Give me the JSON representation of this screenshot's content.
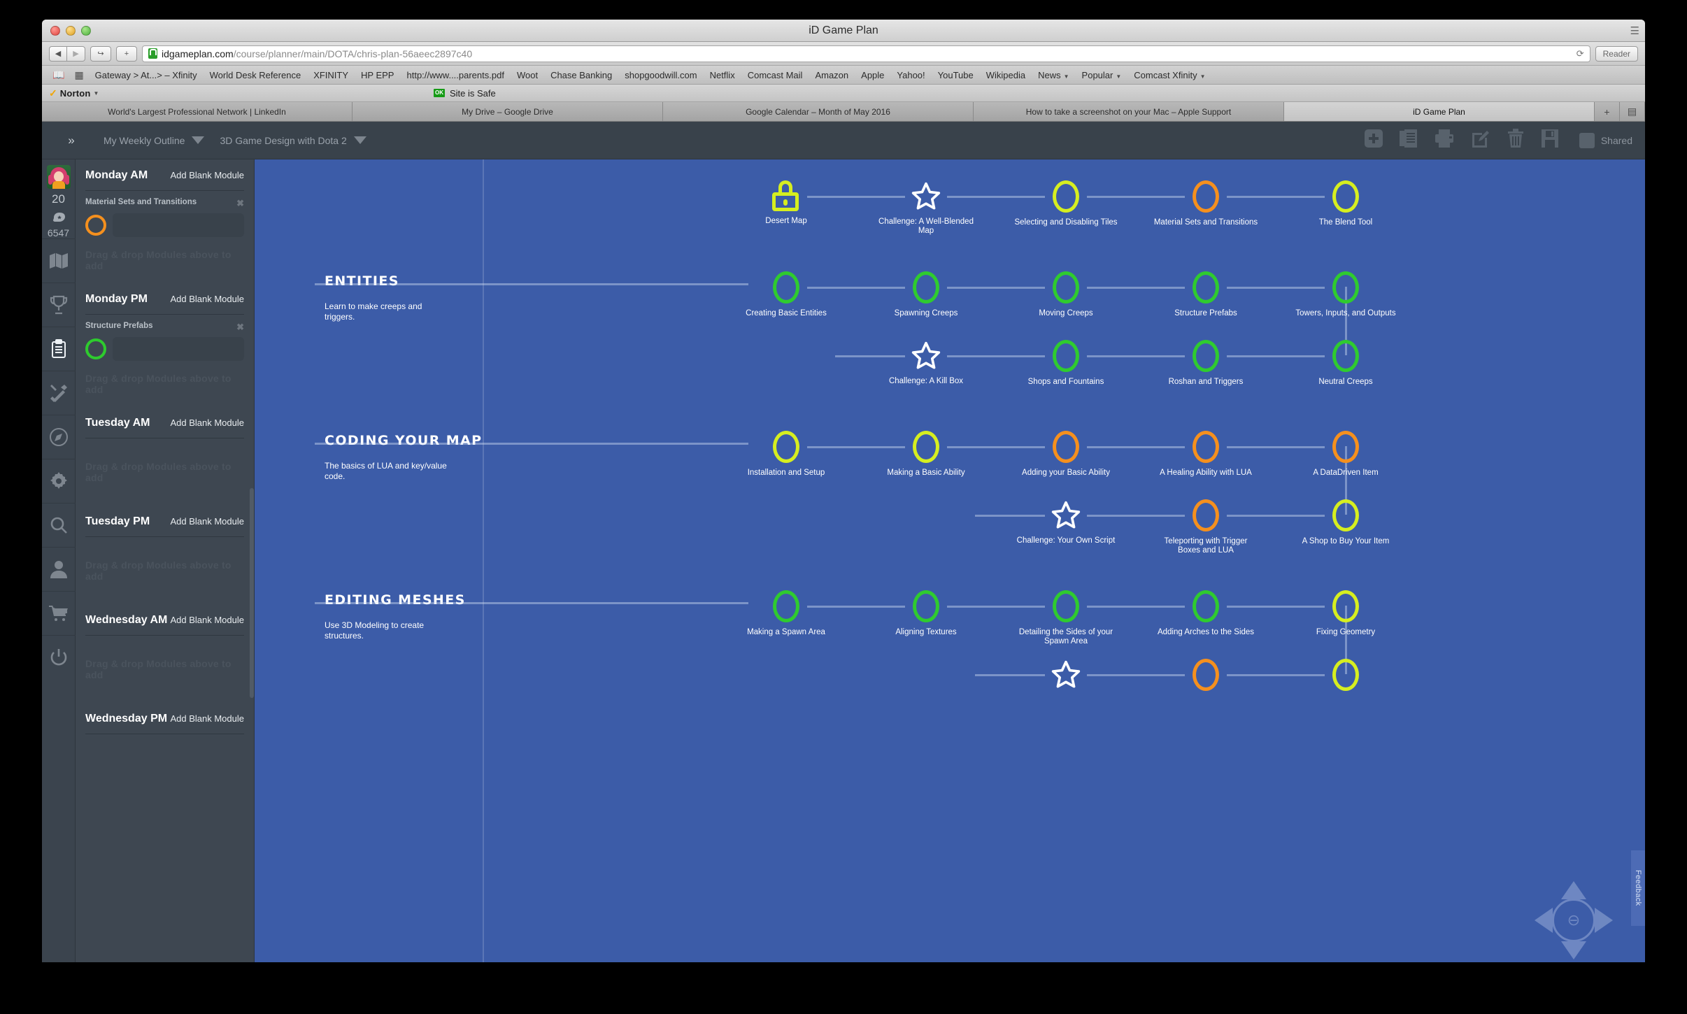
{
  "window": {
    "title": "iD Game Plan"
  },
  "browser": {
    "url_host": "idgameplan.com",
    "url_path": "/course/planner/main/DOTA/chris-plan-56aeec2897c40",
    "reader_label": "Reader",
    "back_glyph": "◀",
    "forward_glyph": "▶",
    "share_glyph": "↪",
    "newtab_glyph": "+",
    "reload_glyph": "⟳",
    "bookmarks_icons": [
      "book-icon",
      "grid-icon"
    ],
    "bookmarks": [
      {
        "label": "Gateway > At...> – Xfinity",
        "dropdown": false
      },
      {
        "label": "World Desk Reference",
        "dropdown": false
      },
      {
        "label": "XFINITY",
        "dropdown": false
      },
      {
        "label": "HP EPP",
        "dropdown": false
      },
      {
        "label": "http://www....parents.pdf",
        "dropdown": false
      },
      {
        "label": "Woot",
        "dropdown": false
      },
      {
        "label": "Chase Banking",
        "dropdown": false
      },
      {
        "label": "shopgoodwill.com",
        "dropdown": false
      },
      {
        "label": "Netflix",
        "dropdown": false
      },
      {
        "label": "Comcast Mail",
        "dropdown": false
      },
      {
        "label": "Amazon",
        "dropdown": false
      },
      {
        "label": "Apple",
        "dropdown": false
      },
      {
        "label": "Yahoo!",
        "dropdown": false
      },
      {
        "label": "YouTube",
        "dropdown": false
      },
      {
        "label": "Wikipedia",
        "dropdown": false
      },
      {
        "label": "News",
        "dropdown": true
      },
      {
        "label": "Popular",
        "dropdown": true
      },
      {
        "label": "Comcast Xfinity",
        "dropdown": true
      }
    ],
    "norton": {
      "label": "Norton",
      "check": "✓",
      "badge": "OK",
      "status": "Site is Safe"
    },
    "tabs": [
      {
        "label": "World's Largest Professional Network | LinkedIn",
        "active": false
      },
      {
        "label": "My Drive – Google Drive",
        "active": false
      },
      {
        "label": "Google Calendar – Month of May 2016",
        "active": false
      },
      {
        "label": "How to take a screenshot on your Mac – Apple Support",
        "active": false
      },
      {
        "label": "iD Game Plan",
        "active": true
      }
    ],
    "tab_controls": [
      "+",
      "▤"
    ]
  },
  "app": {
    "collapse_glyph": "»",
    "selectors": [
      {
        "name": "plan-selector",
        "value": "My Weekly Outline"
      },
      {
        "name": "course-selector",
        "value": "3D Game Design with Dota 2"
      }
    ],
    "toolbar_icons": [
      "add-icon",
      "duplicate-icon",
      "print-icon",
      "edit-icon",
      "delete-icon",
      "save-icon"
    ],
    "shared_label": "Shared"
  },
  "rail": {
    "level": "20",
    "points": "6547",
    "items": [
      {
        "name": "sidebar-item-map",
        "icon": "map-icon",
        "active": false
      },
      {
        "name": "sidebar-item-trophy",
        "icon": "trophy-icon",
        "active": false
      },
      {
        "name": "sidebar-item-planner",
        "icon": "clipboard-icon",
        "active": true
      },
      {
        "name": "sidebar-item-tools",
        "icon": "tools-icon",
        "active": false
      },
      {
        "name": "sidebar-item-explore",
        "icon": "compass-icon",
        "active": false
      },
      {
        "name": "sidebar-item-settings",
        "icon": "gear-icon",
        "active": false
      },
      {
        "name": "sidebar-item-search",
        "icon": "search-icon",
        "active": false
      },
      {
        "name": "sidebar-item-profile",
        "icon": "user-icon",
        "active": false
      },
      {
        "name": "sidebar-item-store",
        "icon": "cart-icon",
        "active": false
      },
      {
        "name": "sidebar-item-logout",
        "icon": "power-icon",
        "active": false
      }
    ]
  },
  "outline": {
    "add_blank_label": "Add Blank Module",
    "drop_hint": "Drag & drop Modules above to add",
    "close_glyph": "✖",
    "days": [
      {
        "name": "Monday AM",
        "module": {
          "title": "Material Sets and Transitions",
          "status_color": "#f5901e"
        }
      },
      {
        "name": "Monday PM",
        "module": {
          "title": "Structure Prefabs",
          "status_color": "#2ecb2e"
        }
      },
      {
        "name": "Tuesday AM",
        "module": null
      },
      {
        "name": "Tuesday PM",
        "module": null
      },
      {
        "name": "Wednesday AM",
        "module": null
      },
      {
        "name": "Wednesday PM",
        "module": null
      }
    ]
  },
  "colors": {
    "canvas_blue": "#3c5ca8",
    "status_yellow": "#d6ee20",
    "status_green": "#2fcb2f",
    "status_orange": "#f5901e",
    "star_white": "#ffffff"
  },
  "canvas": {
    "sections": [
      {
        "title": "ENTITIES",
        "desc": "Learn to make creeps and triggers."
      },
      {
        "title": "CODING YOUR MAP",
        "desc": "The basics of LUA and key/value code."
      },
      {
        "title": "EDITING MESHES",
        "desc": "Use 3D Modeling to create structures."
      }
    ],
    "nodes": [
      {
        "label": "Desert Map",
        "type": "lock",
        "color": "#d6ee20",
        "row": 0,
        "col": 0
      },
      {
        "label": "Challenge: A Well-Blended Map",
        "type": "star",
        "color": "#ffffff",
        "row": 0,
        "col": 1
      },
      {
        "label": "Selecting and Disabling Tiles",
        "type": "ring",
        "color": "#d6ee20",
        "row": 0,
        "col": 2
      },
      {
        "label": "Material Sets and Transitions",
        "type": "ring",
        "color": "#f5901e",
        "row": 0,
        "col": 3
      },
      {
        "label": "The Blend Tool",
        "type": "ring",
        "color": "#d6ee20",
        "row": 0,
        "col": 4
      },
      {
        "label": "Creating Basic Entities",
        "type": "ring",
        "color": "#2fcb2f",
        "row": 1,
        "col": 0
      },
      {
        "label": "Spawning Creeps",
        "type": "ring",
        "color": "#2fcb2f",
        "row": 1,
        "col": 1
      },
      {
        "label": "Moving Creeps",
        "type": "ring",
        "color": "#2fcb2f",
        "row": 1,
        "col": 2
      },
      {
        "label": "Structure Prefabs",
        "type": "ring",
        "color": "#2fcb2f",
        "row": 1,
        "col": 3
      },
      {
        "label": "Towers, Inputs, and Outputs",
        "type": "ring",
        "color": "#2fcb2f",
        "row": 1,
        "col": 4
      },
      {
        "label": "Challenge: A Kill Box",
        "type": "star",
        "color": "#ffffff",
        "row": 2,
        "col": 1
      },
      {
        "label": "Shops and Fountains",
        "type": "ring",
        "color": "#2fcb2f",
        "row": 2,
        "col": 2
      },
      {
        "label": "Roshan and Triggers",
        "type": "ring",
        "color": "#2fcb2f",
        "row": 2,
        "col": 3
      },
      {
        "label": "Neutral Creeps",
        "type": "ring",
        "color": "#2fcb2f",
        "row": 2,
        "col": 4
      },
      {
        "label": "Installation and Setup",
        "type": "ring",
        "color": "#d6ee20",
        "row": 3,
        "col": 0
      },
      {
        "label": "Making a Basic Ability",
        "type": "ring",
        "color": "#d6ee20",
        "row": 3,
        "col": 1
      },
      {
        "label": "Adding your Basic Ability",
        "type": "ring",
        "color": "#f5901e",
        "row": 3,
        "col": 2
      },
      {
        "label": "A Healing Ability with LUA",
        "type": "ring",
        "color": "#f5901e",
        "row": 3,
        "col": 3
      },
      {
        "label": "A DataDriven Item",
        "type": "ring",
        "color": "#f5901e",
        "row": 3,
        "col": 4
      },
      {
        "label": "Challenge: Your Own Script",
        "type": "star",
        "color": "#ffffff",
        "row": 4,
        "col": 2
      },
      {
        "label": "Teleporting with Trigger Boxes and LUA",
        "type": "ring",
        "color": "#f5901e",
        "row": 4,
        "col": 3
      },
      {
        "label": "A Shop to Buy Your Item",
        "type": "ring",
        "color": "#d6ee20",
        "row": 4,
        "col": 4
      },
      {
        "label": "Making a Spawn Area",
        "type": "ring",
        "color": "#2fcb2f",
        "row": 5,
        "col": 0
      },
      {
        "label": "Aligning Textures",
        "type": "ring",
        "color": "#2fcb2f",
        "row": 5,
        "col": 1
      },
      {
        "label": "Detailing the Sides of your Spawn Area",
        "type": "ring",
        "color": "#2fcb2f",
        "row": 5,
        "col": 2
      },
      {
        "label": "Adding Arches to the Sides",
        "type": "ring",
        "color": "#2fcb2f",
        "row": 5,
        "col": 3
      },
      {
        "label": "Fixing Geometry",
        "type": "ring",
        "color": "#d6ee20",
        "row": 5,
        "col": 4
      },
      {
        "label": "",
        "type": "star",
        "color": "#ffffff",
        "row": 6,
        "col": 2
      },
      {
        "label": "",
        "type": "ring",
        "color": "#f5901e",
        "row": 6,
        "col": 3
      },
      {
        "label": "",
        "type": "ring",
        "color": "#d6ee20",
        "row": 6,
        "col": 4
      }
    ],
    "feedback_label": "Feedback",
    "zoom_out_glyph": "⊖"
  }
}
